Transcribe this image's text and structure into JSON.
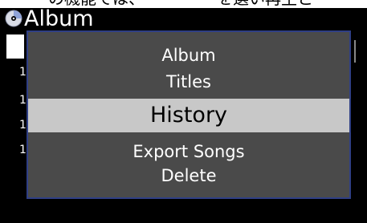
{
  "window": {
    "title": "Album"
  },
  "top_strip": {
    "text": "の機能では、　　　　　を選い再生と"
  },
  "background_list": {
    "row_digits": [
      "1",
      "1",
      "1",
      "1"
    ]
  },
  "menu": {
    "items": [
      {
        "label": "Album",
        "selected": false
      },
      {
        "label": "Titles",
        "selected": false
      },
      {
        "label": "History",
        "selected": true
      },
      {
        "label": "Export Songs",
        "selected": false
      },
      {
        "label": "Delete",
        "selected": false
      }
    ]
  },
  "colors": {
    "background": "#000000",
    "menu_bg": "#4a4a4a",
    "menu_border": "#2f3f85",
    "selected_bg": "#c8c8c8",
    "text": "#ffffff"
  },
  "icons": {
    "title_icon": "cd-disc-icon"
  }
}
